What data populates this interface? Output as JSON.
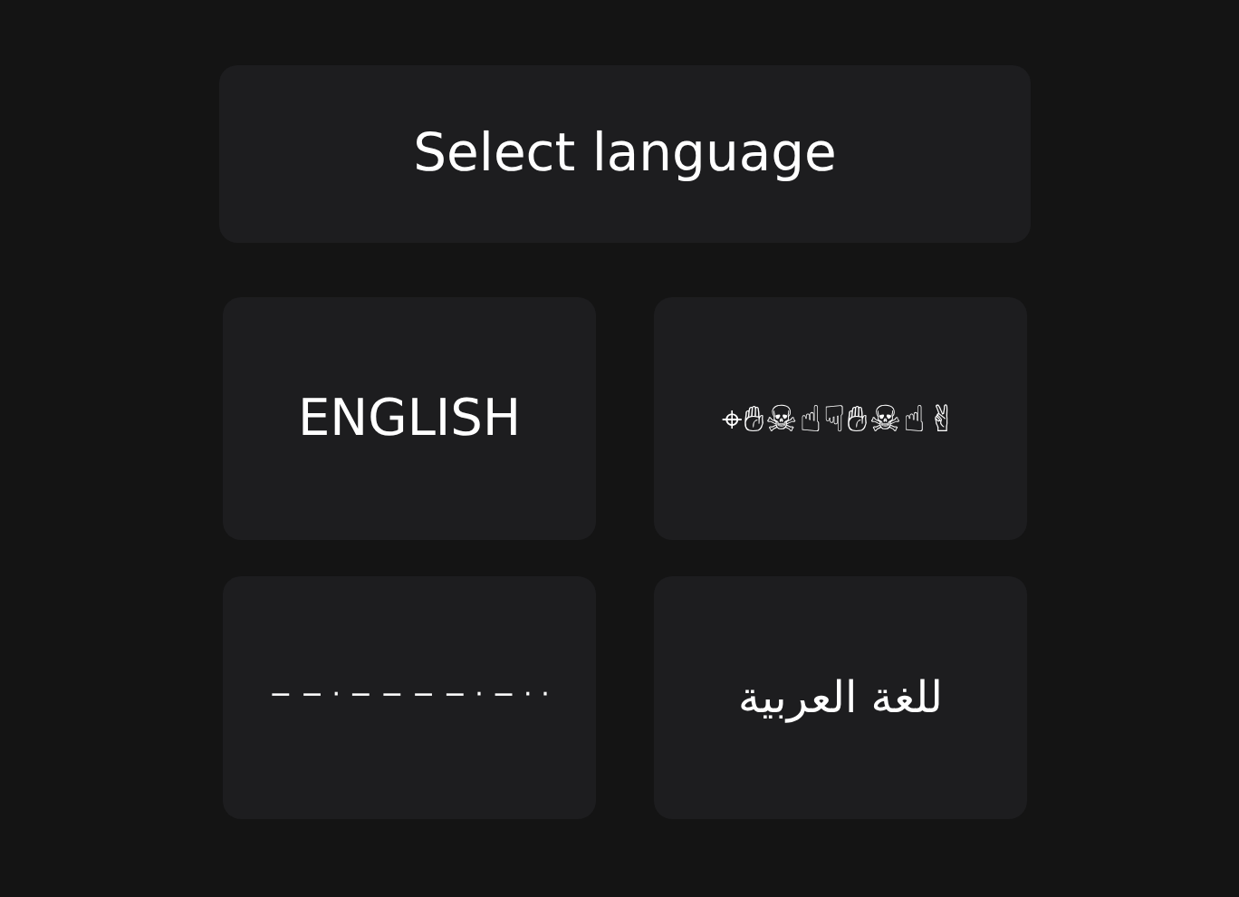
{
  "title": "Select language",
  "languages": [
    {
      "label": "ENGLISH",
      "kind": "text"
    },
    {
      "label": "⌖✋︎☠☝☟✋︎☠☝✌",
      "kind": "symbols"
    },
    {
      "label": "− − · − − − − · − · ·",
      "kind": "morse"
    },
    {
      "label": "للغة العربية",
      "kind": "rtl"
    }
  ]
}
